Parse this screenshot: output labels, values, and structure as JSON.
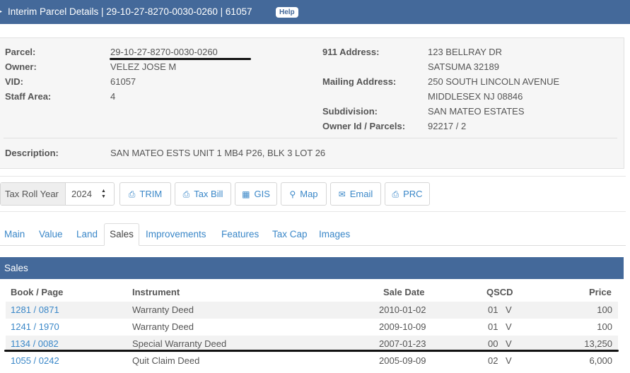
{
  "header": {
    "title": "Interim Parcel Details | 29-10-27-8270-0030-0260 | 61057",
    "help_label": "Help"
  },
  "info": {
    "left": [
      {
        "label": "Parcel:",
        "value": "29-10-27-8270-0030-0260"
      },
      {
        "label": "Owner:",
        "value": "VELEZ JOSE M"
      },
      {
        "label": "VID:",
        "value": "61057"
      },
      {
        "label": "Staff Area:",
        "value": "4"
      }
    ],
    "right": {
      "address_label": "911 Address:",
      "address_line1": "123 BELLRAY DR",
      "address_line2": "SATSUMA 32189",
      "mailing_label": "Mailing Address:",
      "mailing_line1": "250 SOUTH LINCOLN AVENUE",
      "mailing_line2": "MIDDLESEX NJ 08846",
      "subdivision_label": "Subdivision:",
      "subdivision_value": "SAN MATEO ESTATES",
      "ownerid_label": "Owner Id / Parcels:",
      "ownerid_value": "92217 / 2"
    },
    "description_label": "Description:",
    "description_value": "SAN MATEO ESTS UNIT 1 MB4 P26, BLK 3 LOT 26"
  },
  "toolbar": {
    "tax_roll_label": "Tax Roll Year",
    "year_value": "2024",
    "buttons": [
      {
        "label": "TRIM",
        "icon": "print-icon"
      },
      {
        "label": "Tax Bill",
        "icon": "print-icon"
      },
      {
        "label": "GIS",
        "icon": "map-grid-icon"
      },
      {
        "label": "Map",
        "icon": "map-marker-icon"
      },
      {
        "label": "Email",
        "icon": "envelope-icon"
      },
      {
        "label": "PRC",
        "icon": "print-icon"
      }
    ]
  },
  "tabs": [
    "Main",
    "Value",
    "Land",
    "Sales",
    "Improvements",
    "Features",
    "Tax Cap",
    "Images"
  ],
  "active_tab": "Sales",
  "sales": {
    "heading": "Sales",
    "columns": {
      "book_page": "Book / Page",
      "instrument": "Instrument",
      "sale_date": "Sale Date",
      "qscd": "QSCD",
      "price": "Price"
    },
    "rows": [
      {
        "book_page": "1281 / 0871",
        "instrument": "Warranty Deed",
        "sale_date": "2010-01-02",
        "qscd": "01",
        "qscd_flag": "V",
        "price": "100"
      },
      {
        "book_page": "1241 / 1970",
        "instrument": "Warranty Deed",
        "sale_date": "2009-10-09",
        "qscd": "01",
        "qscd_flag": "V",
        "price": "100"
      },
      {
        "book_page": "1134 / 0082",
        "instrument": "Special Warranty Deed",
        "sale_date": "2007-01-23",
        "qscd": "00",
        "qscd_flag": "V",
        "price": "13,250"
      },
      {
        "book_page": "1055 / 0242",
        "instrument": "Quit Claim Deed",
        "sale_date": "2005-09-09",
        "qscd": "02",
        "qscd_flag": "V",
        "price": "6,000"
      }
    ]
  },
  "colors": {
    "header_bar": "#44699a",
    "link": "#3a87c8",
    "ink": "#111111"
  }
}
